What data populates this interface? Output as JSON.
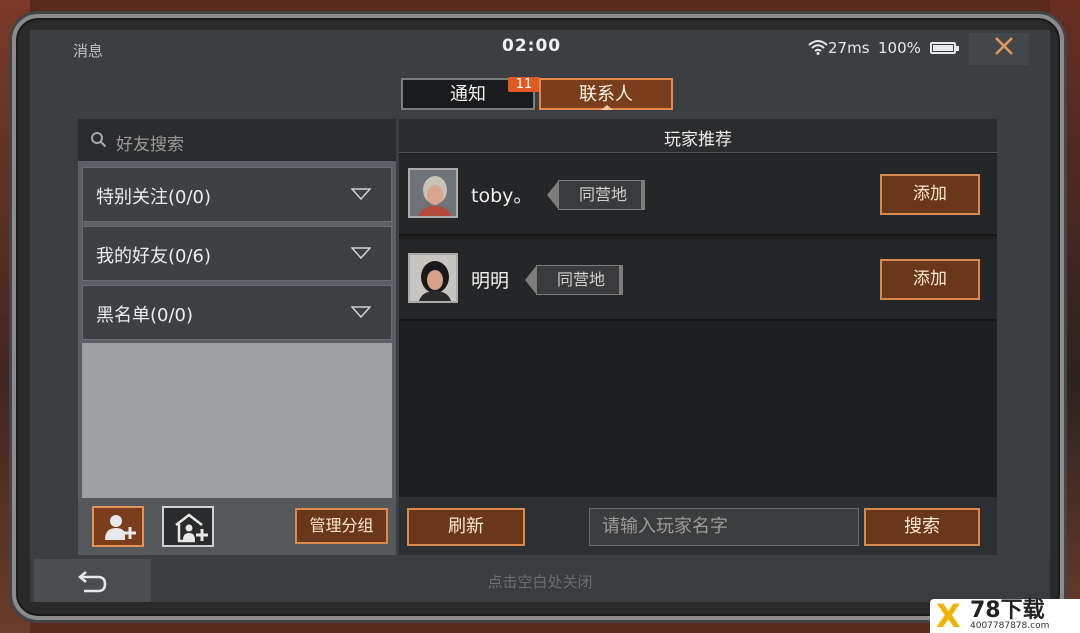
{
  "status_bar": {
    "title": "消息",
    "time": "02:00",
    "ping": "27ms",
    "battery": "100%",
    "battery_level": 1.0
  },
  "tabs": [
    {
      "label": "通知",
      "badge": "11",
      "active": false
    },
    {
      "label": "联系人",
      "active": true
    }
  ],
  "left_panel": {
    "search_placeholder": "好友搜索",
    "groups": [
      {
        "label": "特别关注(0/0)"
      },
      {
        "label": "我的好友(0/6)"
      },
      {
        "label": "黑名单(0/0)"
      }
    ],
    "manage_label": "管理分组"
  },
  "right_panel": {
    "header": "玩家推荐",
    "players": [
      {
        "name": "toby。",
        "tag": "同营地",
        "button": "添加"
      },
      {
        "name": "明明",
        "tag": "同营地",
        "button": "添加"
      }
    ],
    "refresh_label": "刷新",
    "name_placeholder": "请输入玩家名字",
    "search_label": "搜索"
  },
  "bottom": {
    "close_hint": "点击空白处关闭"
  },
  "watermark": {
    "mark": "X",
    "text": "78下载",
    "sub": "4007787878.com"
  },
  "colors": {
    "accent_orange": "#d98a4f",
    "button_bg": "#6b371a",
    "badge": "#e05a22"
  }
}
